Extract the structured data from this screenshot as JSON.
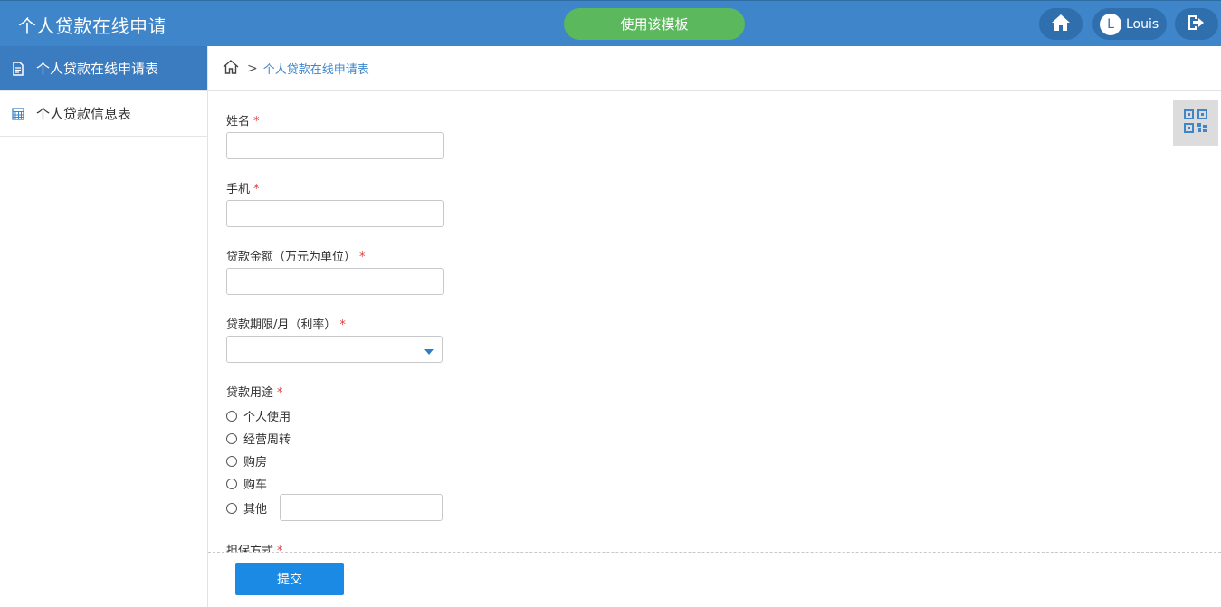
{
  "header": {
    "title": "个人贷款在线申请",
    "use_template_label": "使用该模板",
    "user": {
      "avatar_letter": "L",
      "name": "Louis"
    }
  },
  "sidebar": {
    "items": [
      {
        "label": "个人贷款在线申请表",
        "icon": "document-icon",
        "active": true
      },
      {
        "label": "个人贷款信息表",
        "icon": "table-icon",
        "active": false
      }
    ]
  },
  "breadcrumb": {
    "separator": ">",
    "current": "个人贷款在线申请表"
  },
  "form": {
    "required_mark": "*",
    "name_label": "姓名",
    "phone_label": "手机",
    "amount_label": "贷款金额（万元为单位）",
    "term_label": "贷款期限/月（利率）",
    "purpose_label": "贷款用途",
    "purpose_options": [
      "个人使用",
      "经营周转",
      "购房",
      "购车",
      "其他"
    ],
    "guarantee_label": "担保方式"
  },
  "footer": {
    "submit_label": "提交"
  },
  "colors": {
    "primary": "#3f85c9",
    "accent_green": "#5cb85c",
    "submit_blue": "#1a8ae5",
    "required_red": "#e23b3b"
  }
}
